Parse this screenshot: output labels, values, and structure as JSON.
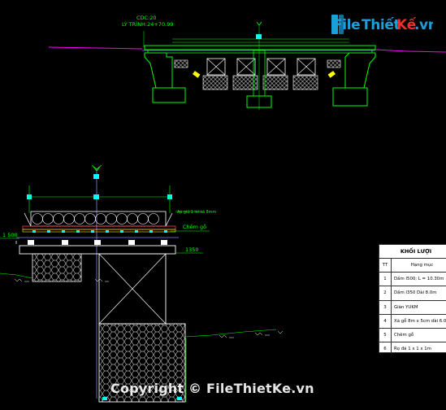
{
  "elevation": {
    "cdc_label": "CDC:20",
    "ly_trinh_label": "LÝ TRÌNH:24+70.99"
  },
  "section": {
    "dim_1500": "1 500",
    "dim_1350": "1350",
    "label_cheme": "Chêm gỗ",
    "label_ap": "Ap giữ 1 lol cá 8mm"
  },
  "quantity_table": {
    "title": "KHỐI LƯỢI",
    "header_tt": "TT",
    "header_item": "Hạng mục",
    "rows": [
      {
        "tt": "1",
        "item": "Dầm I500; L = 10.30m"
      },
      {
        "tt": "2",
        "item": "Dầm I350 Dài 8.0m"
      },
      {
        "tt": "3",
        "item": "Giàn YUKM"
      },
      {
        "tt": "4",
        "item": "Xà gỗ 8m x 5cm dài 6.0"
      },
      {
        "tt": "5",
        "item": "Chêm gỗ"
      },
      {
        "tt": "6",
        "item": "Rọ đá 1 x 1 x 1m"
      }
    ]
  },
  "watermark": {
    "logo_file": "File",
    "logo_thiet": "Thiết",
    "logo_ke": "Kế",
    "logo_vn": ".vn",
    "copyright": "Copyright © FileThietKe.vn"
  },
  "colors": {
    "background": "#000000",
    "structure_green": "#00ff00",
    "dimension_cyan": "#00ffff",
    "ground_magenta": "#ff00ff",
    "structure_white": "#ffffff",
    "lane_yellow": "#ffff00",
    "accent_purple": "#8080ff"
  }
}
